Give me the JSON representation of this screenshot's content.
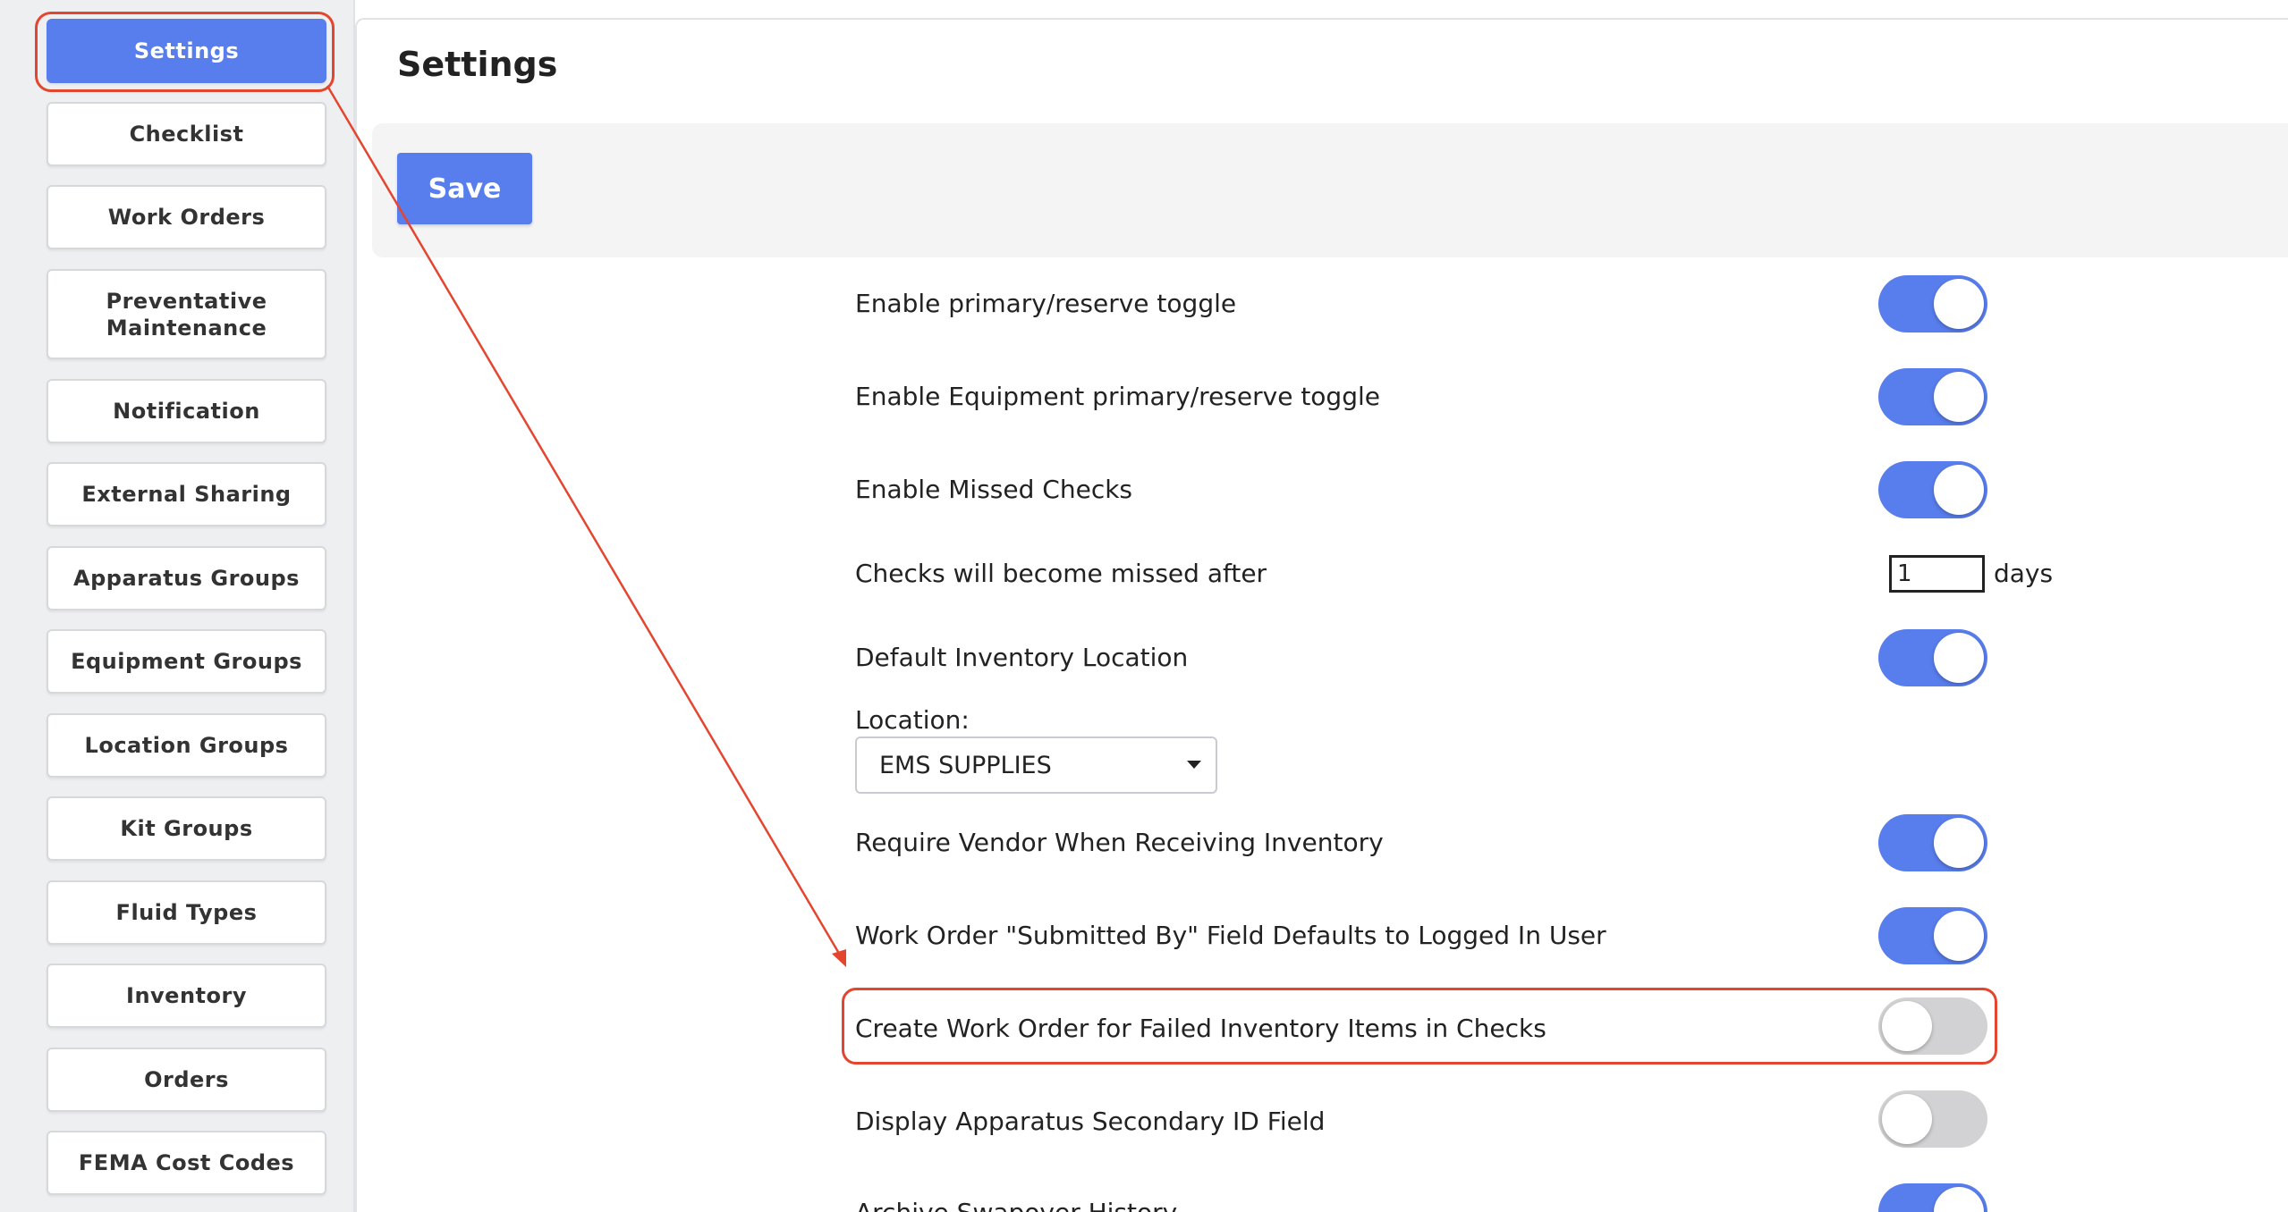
{
  "sidebar": {
    "items": [
      {
        "label": "Settings",
        "active": true
      },
      {
        "label": "Checklist"
      },
      {
        "label": "Work Orders"
      },
      {
        "label": "Preventative Maintenance"
      },
      {
        "label": "Notification"
      },
      {
        "label": "External Sharing"
      },
      {
        "label": "Apparatus Groups"
      },
      {
        "label": "Equipment Groups"
      },
      {
        "label": "Location Groups"
      },
      {
        "label": "Kit Groups"
      },
      {
        "label": "Fluid Types"
      },
      {
        "label": "Inventory"
      },
      {
        "label": "Orders"
      },
      {
        "label": "FEMA Cost Codes"
      }
    ]
  },
  "page": {
    "title": "Settings",
    "save_label": "Save"
  },
  "settings": {
    "primary_reserve": {
      "label": "Enable primary/reserve toggle",
      "enabled": true
    },
    "equipment_primary_reserve": {
      "label": "Enable Equipment primary/reserve toggle",
      "enabled": true
    },
    "missed_checks": {
      "label": "Enable Missed Checks",
      "enabled": true
    },
    "missed_after": {
      "label": "Checks will become missed after",
      "value": "1",
      "unit": "days"
    },
    "default_inventory_location": {
      "label": "Default Inventory Location",
      "enabled": true
    },
    "location": {
      "label": "Location:",
      "selected": "EMS SUPPLIES"
    },
    "require_vendor": {
      "label": "Require Vendor When Receiving Inventory",
      "enabled": true
    },
    "submitted_by_default": {
      "label": "Work Order \"Submitted By\" Field Defaults to Logged In User",
      "enabled": true
    },
    "create_work_order_failed": {
      "label": "Create Work Order for Failed Inventory Items in Checks",
      "enabled": false
    },
    "secondary_id": {
      "label": "Display Apparatus Secondary ID Field",
      "enabled": false
    },
    "archive_swapover": {
      "label": "Archive Swapover History",
      "enabled": true
    }
  },
  "colors": {
    "accent": "#587dec",
    "annotation": "#e4452f",
    "toggle_off": "#d2d2d4"
  }
}
